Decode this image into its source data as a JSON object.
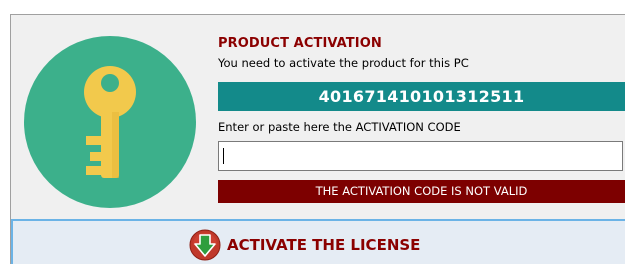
{
  "colors": {
    "title": "#8b0000",
    "code_bar": "#138a8a",
    "error_bar": "#7d0000",
    "key_circle": "#3cb08b",
    "key_body": "#f2c94c",
    "button_bg": "#e5ecf4",
    "button_border": "#6bb3e6"
  },
  "header": {
    "title": "PRODUCT ACTIVATION",
    "subtitle": "You need to activate the product for this PC"
  },
  "pc_code": "401671410101312511",
  "activation": {
    "label": "Enter or paste here the ACTIVATION CODE",
    "value": "",
    "error": "THE ACTIVATION CODE IS NOT VALID"
  },
  "button": {
    "label": "ACTIVATE THE LICENSE",
    "icon": "download-arrow-icon"
  },
  "icon": "key-icon"
}
